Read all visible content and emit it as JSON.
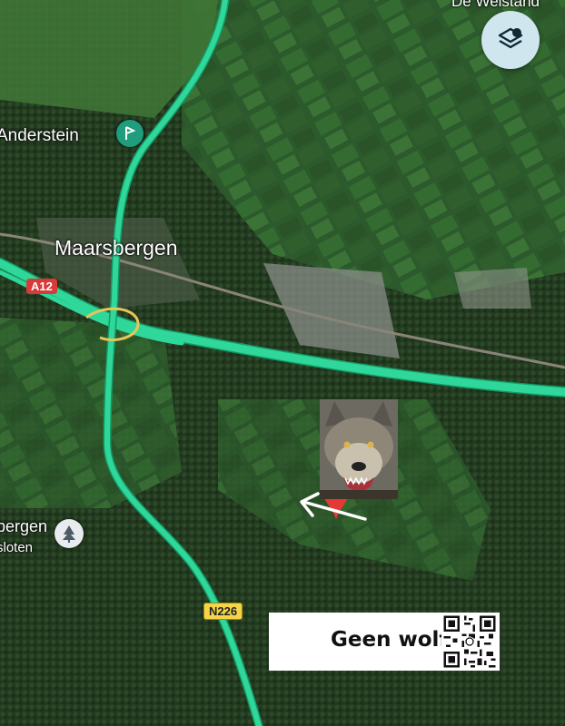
{
  "map": {
    "places": {
      "de_welstand": "De Welstand",
      "anderstein": "Anderstein",
      "maarsbergen": "Maarsbergen",
      "bergen": "bergen",
      "sloten": "sloten"
    },
    "roads": {
      "a12": "A12",
      "n226": "N226"
    },
    "colors": {
      "road": "#2fd89a",
      "road_edge": "#129a66",
      "a12_badge": "#d83a3a",
      "n226_badge": "#f5d547",
      "pin": "#e53935",
      "layers_button_bg": "#cfe6ee"
    }
  },
  "controls": {
    "layers_icon": "layers-icon"
  },
  "overlay": {
    "text": "Geen wolf"
  }
}
